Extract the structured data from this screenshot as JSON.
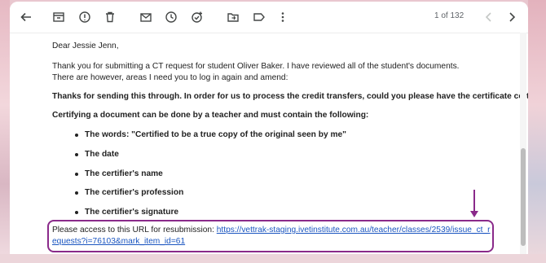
{
  "toolbar": {
    "pager": "1 of 132",
    "icons": [
      "back-arrow-icon",
      "archive-icon",
      "report-spam-icon",
      "delete-icon",
      "mark-unread-icon",
      "snooze-icon",
      "add-task-icon",
      "move-to-icon",
      "label-icon",
      "more-options-icon",
      "newer-icon",
      "older-icon"
    ]
  },
  "email": {
    "greeting": "Dear Jessie Jenn,",
    "line1": "Thank you for submitting a CT request for student Oliver Baker. I have reviewed all of the student's documents.",
    "line2": "There are however, areas I need you to log in again and amend:",
    "bold1": "Thanks for sending this through. In order for us to process the credit transfers, could you please have the certificate certified?",
    "bold2": "Certifying a document can be done by a teacher and must contain the following:",
    "bullets": [
      "The words: \"Certified to be a true copy of the original seen by me\"",
      "The date",
      "The certifier's name",
      "The certifier's profession",
      "The certifier's signature"
    ],
    "url_intro": "Please access to this URL for resubmission: ",
    "url": "https://vettrak-staging.ivetinstitute.com.au/teacher/classes/2539/issue_ct_requests?i=76103&mark_item_id=61"
  },
  "colors": {
    "highlight": "#8a2a8a",
    "link": "#1a55c0"
  }
}
